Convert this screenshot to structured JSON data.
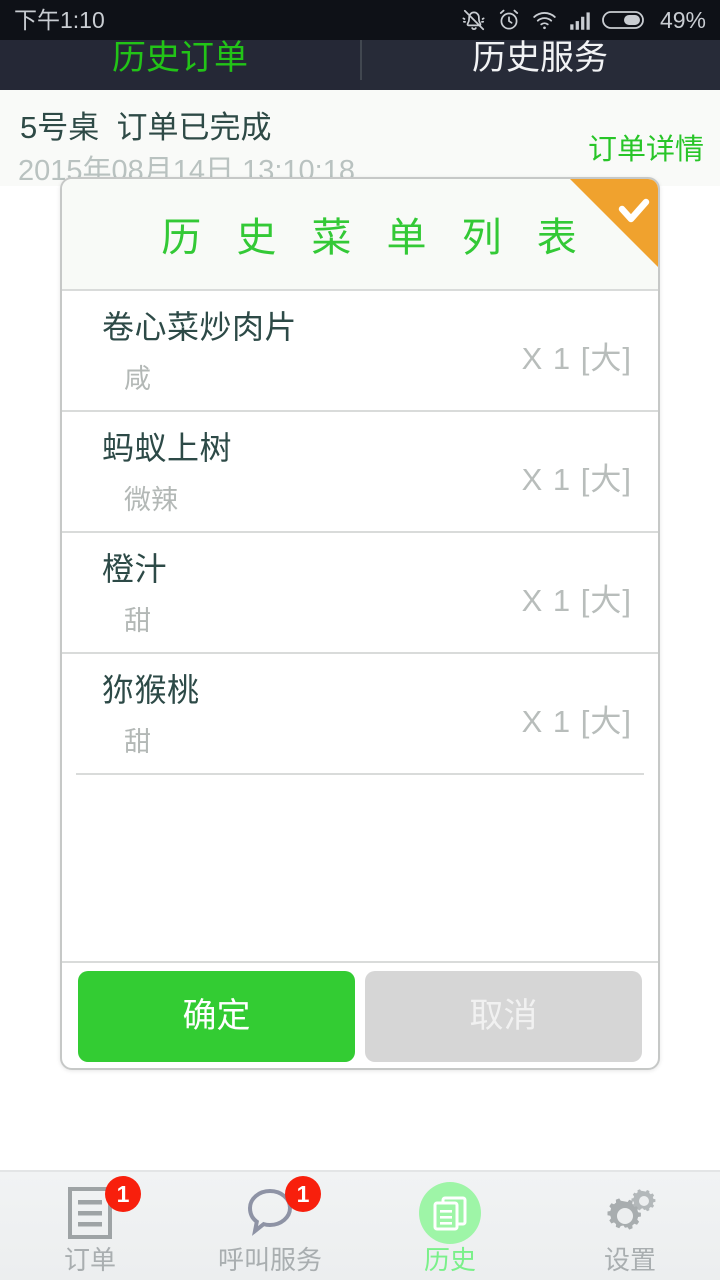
{
  "status_bar": {
    "time": "下午1:10",
    "battery_percent": "49%",
    "icons": [
      "bell-muted-icon",
      "alarm-clock-icon",
      "wifi-icon",
      "signal-bars-icon",
      "battery-icon"
    ]
  },
  "tabs": [
    {
      "label": "历史订单",
      "active": true,
      "color": "#22c417"
    },
    {
      "label": "历史服务",
      "active": false,
      "color": "#f2f3f5"
    }
  ],
  "order_header": {
    "table_label": "5号桌",
    "status_label": "订单已完成",
    "title_combined": "5号桌  订单已完成",
    "datetime": "2015年08月14日  13:10:18",
    "detail_link": "订单详情"
  },
  "dialog": {
    "title": "历 史 菜 单 列 表",
    "ribbon_icon": "check-icon",
    "ribbon_color": "#f0a22e",
    "items": [
      {
        "name": "卷心菜炒肉片",
        "taste": "咸",
        "qty": "X 1 [大]"
      },
      {
        "name": "蚂蚁上树",
        "taste": "微辣",
        "qty": "X 1 [大]"
      },
      {
        "name": "橙汁",
        "taste": "甜",
        "qty": "X 1 [大]"
      },
      {
        "name": "狝猴桃",
        "taste": "甜",
        "qty": "X 1 [大]"
      }
    ],
    "confirm_label": "确定",
    "cancel_label": "取消",
    "confirm_color": "#33cc33",
    "cancel_color": "#d6d6d6"
  },
  "bottom_nav": {
    "items": [
      {
        "label": "订单",
        "icon": "document-lines-icon",
        "badge": "1",
        "active": false
      },
      {
        "label": "呼叫服务",
        "icon": "speech-bubble-icon",
        "badge": "1",
        "active": false
      },
      {
        "label": "历史",
        "icon": "documents-stack-icon",
        "badge": "",
        "active": true
      },
      {
        "label": "设置",
        "icon": "gears-icon",
        "badge": "",
        "active": false
      }
    ],
    "active_color": "#7bf08a",
    "badge_color": "#f81f0c"
  }
}
